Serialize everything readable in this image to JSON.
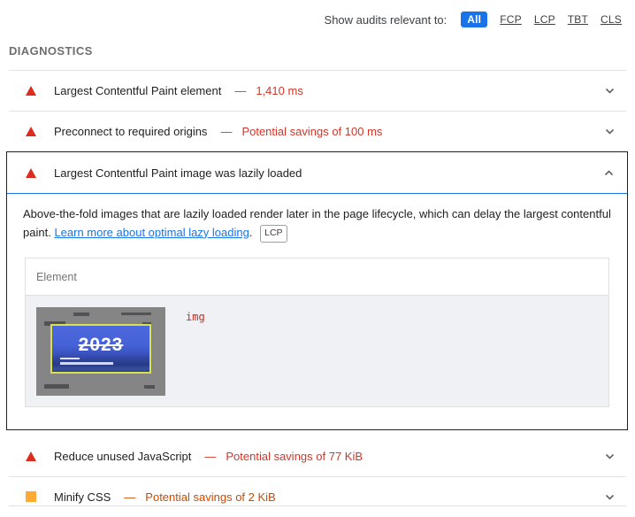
{
  "filter_bar": {
    "label": "Show audits relevant to:",
    "chips": {
      "all": "All",
      "fcp": "FCP",
      "lcp": "LCP",
      "tbt": "TBT",
      "cls": "CLS"
    }
  },
  "section_title": "DIAGNOSTICS",
  "audits": [
    {
      "title": "Largest Contentful Paint element",
      "separator": "—",
      "value": "1,410 ms",
      "severity": "fail"
    },
    {
      "title": "Preconnect to required origins",
      "separator": "—",
      "value": "Potential savings of 100 ms",
      "severity": "fail"
    },
    {
      "title": "Largest Contentful Paint image was lazily loaded",
      "severity": "fail",
      "expanded": true
    },
    {
      "title": "Reduce unused JavaScript",
      "separator": "—",
      "value": "Potential savings of 77 KiB",
      "severity": "fail"
    },
    {
      "title": "Minify CSS",
      "separator": "—",
      "value": "Potential savings of 2 KiB",
      "severity": "average"
    }
  ],
  "expanded_audit": {
    "description": "Above-the-fold images that are lazily loaded render later in the page lifecycle, which can delay the largest contentful paint.",
    "link_text": "Learn more about optimal lazy loading",
    "link_suffix": ".",
    "badge": "LCP",
    "table": {
      "header": "Element",
      "node_label": "img",
      "thumbnail_text": "2023"
    }
  },
  "colors": {
    "fail_text": "#d43529",
    "average_text": "#d04900",
    "fail_icon": "#dc2c1e",
    "average_icon": "#ffaa33",
    "accent_blue": "#1a73e8"
  }
}
